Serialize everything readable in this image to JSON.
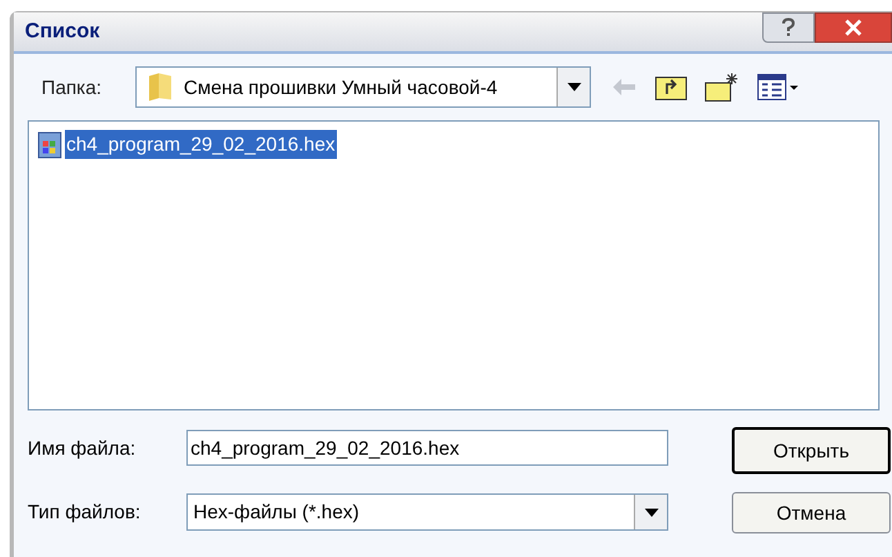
{
  "window": {
    "title": "Список"
  },
  "folder": {
    "label": "Папка:",
    "value": "Смена прошивки Умный часовой-4"
  },
  "files": [
    {
      "name": "ch4_program_29_02_2016.hex",
      "selected": true
    }
  ],
  "file_name": {
    "label": "Имя файла:",
    "value": "ch4_program_29_02_2016.hex"
  },
  "file_type": {
    "label": "Тип файлов:",
    "value": "Hex-файлы (*.hex)"
  },
  "buttons": [
    {
      "label": "Открыть",
      "default": true
    },
    {
      "label": "Отмена",
      "default": false
    }
  ]
}
